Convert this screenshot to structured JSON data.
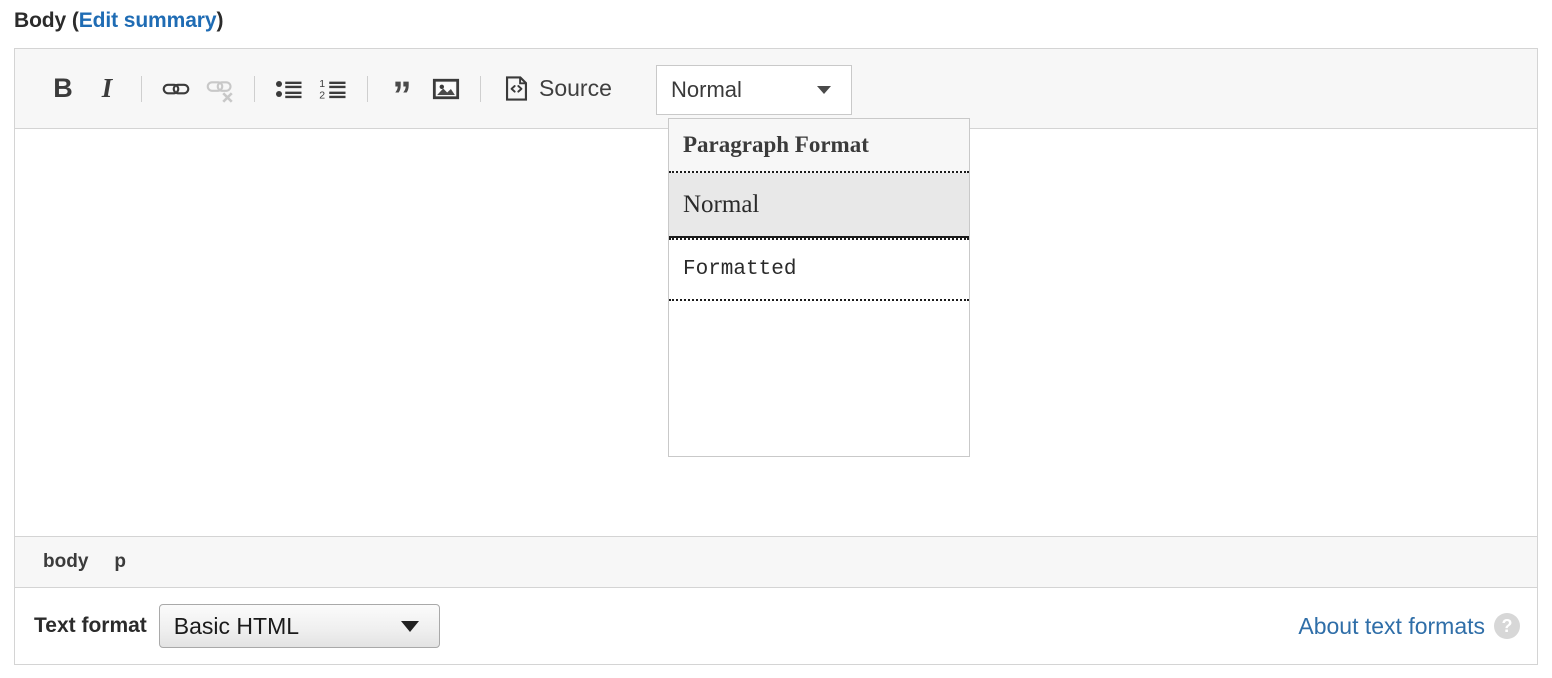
{
  "field": {
    "label": "Body",
    "edit_summary_link": "Edit summary",
    "open_paren": "(",
    "close_paren": ")"
  },
  "toolbar": {
    "buttons": [
      {
        "name": "bold-button",
        "icon": "bold-icon",
        "label": "B",
        "disabled": false
      },
      {
        "name": "italic-button",
        "icon": "italic-icon",
        "label": "I",
        "disabled": false
      },
      {
        "name": "link-button",
        "icon": "link-icon",
        "label": "",
        "disabled": false
      },
      {
        "name": "unlink-button",
        "icon": "unlink-icon",
        "label": "",
        "disabled": true
      },
      {
        "name": "bulleted-list-button",
        "icon": "bulleted-list-icon",
        "label": "",
        "disabled": false
      },
      {
        "name": "numbered-list-button",
        "icon": "numbered-list-icon",
        "label": "",
        "disabled": false
      },
      {
        "name": "blockquote-button",
        "icon": "blockquote-icon",
        "label": "”",
        "disabled": false
      },
      {
        "name": "image-button",
        "icon": "image-icon",
        "label": "",
        "disabled": false
      }
    ],
    "source_button": {
      "label": "Source",
      "icon": "source-code-icon"
    },
    "format_combo": {
      "value": "Normal",
      "caret_icon": "chevron-down-icon"
    }
  },
  "format_panel": {
    "header": "Paragraph Format",
    "items": [
      {
        "label": "Normal",
        "selected": true,
        "style": "serif"
      },
      {
        "label": "Formatted",
        "selected": false,
        "style": "monospace"
      }
    ]
  },
  "path_bar": {
    "items": [
      "body",
      "p"
    ]
  },
  "format_row": {
    "label": "Text format",
    "select_value": "Basic HTML",
    "select_options": [
      "Basic HTML"
    ],
    "about_link": "About text formats",
    "help_icon": "help-circle-icon",
    "help_glyph": "?"
  },
  "colors": {
    "link": "#1f6cb4",
    "about_link": "#2f6ea8",
    "toolbar_bg": "#f7f7f7",
    "border": "#d4d4d4",
    "highlight": "#e8e8e8",
    "disabled_icon": "#c8c8c8"
  }
}
